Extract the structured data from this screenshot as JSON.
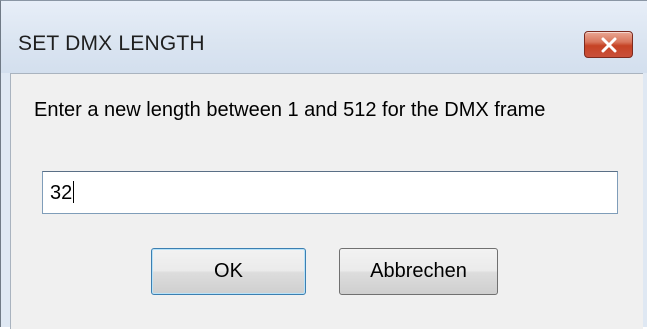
{
  "dialog": {
    "title": "SET DMX LENGTH",
    "prompt": "Enter a new length between 1 and 512 for the DMX frame",
    "input_value": "32",
    "ok_label": "OK",
    "cancel_label": "Abbrechen",
    "close_icon": "close-icon"
  },
  "colors": {
    "titlebar": "#dbe5f1",
    "client_background": "#f0f0f0",
    "close_button": "#c64325"
  }
}
